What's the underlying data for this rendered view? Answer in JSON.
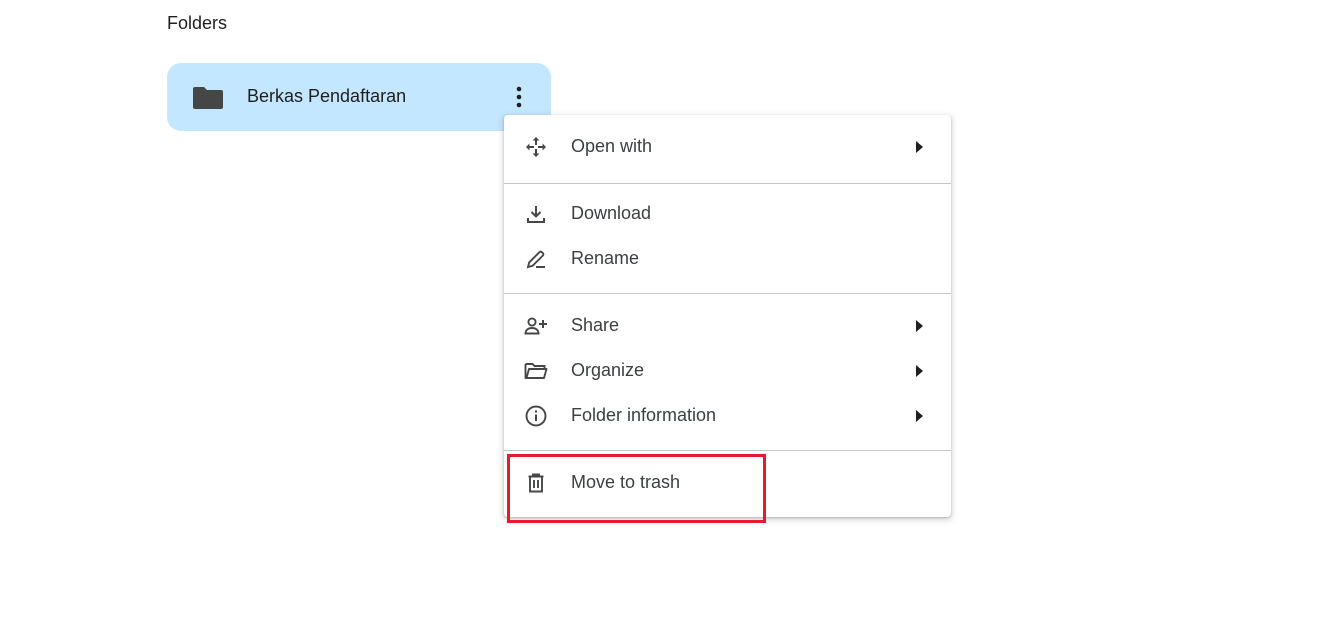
{
  "section": {
    "title": "Folders"
  },
  "folder": {
    "name": "Berkas Pendaftaran"
  },
  "menu": {
    "open_with": "Open with",
    "download": "Download",
    "rename": "Rename",
    "share": "Share",
    "organize": "Organize",
    "folder_information": "Folder information",
    "move_to_trash": "Move to trash"
  },
  "colors": {
    "folder_card_bg": "#c2e7ff",
    "highlight": "#e8192c",
    "icon": "#444746"
  }
}
